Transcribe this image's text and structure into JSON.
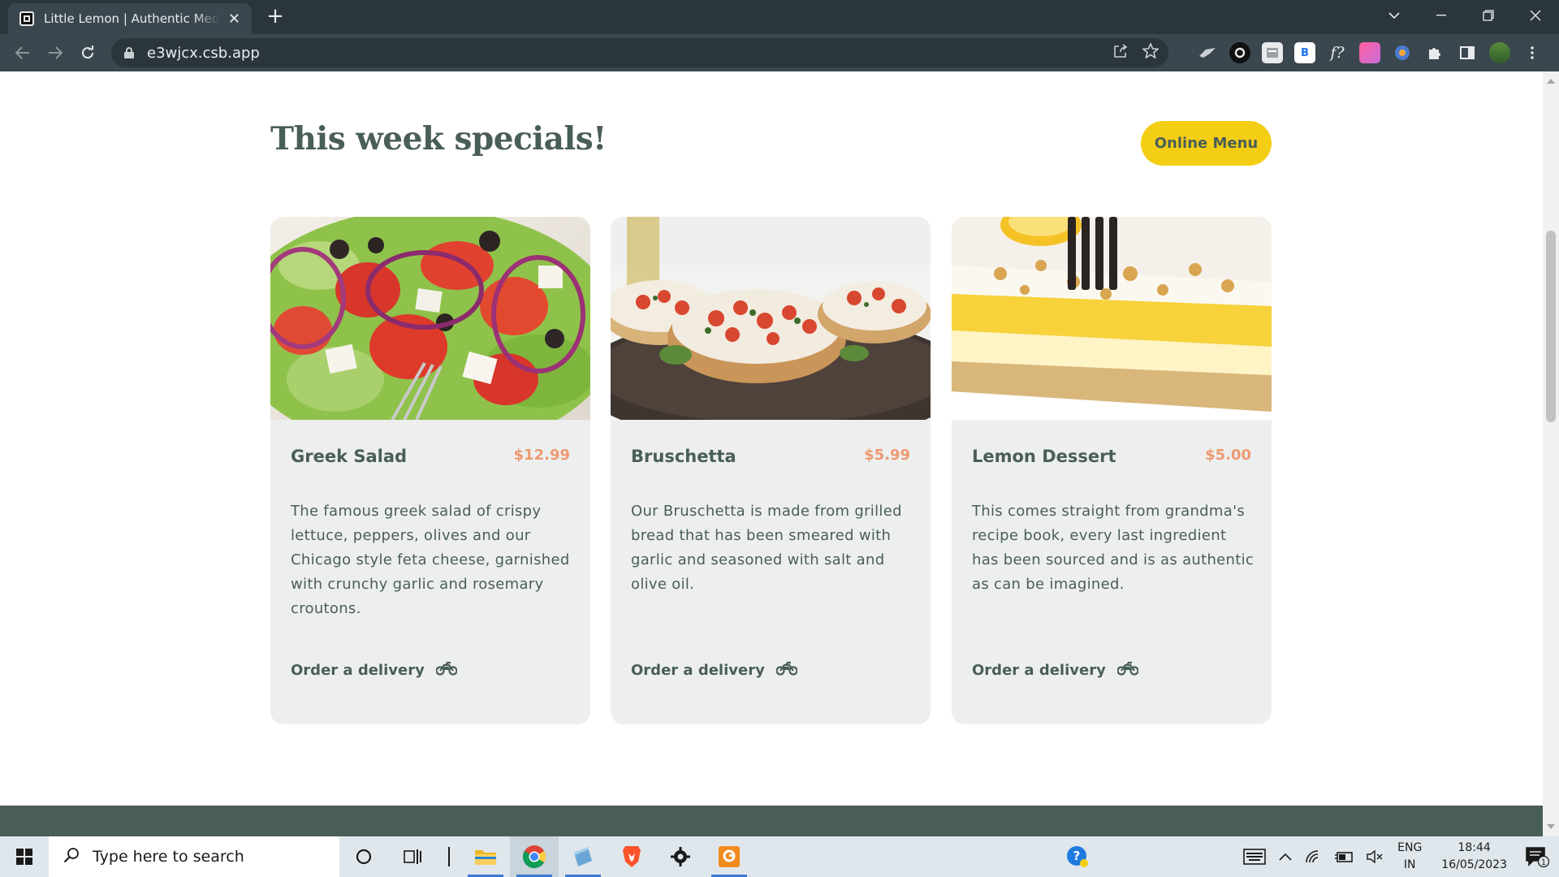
{
  "browser": {
    "tab_title": "Little Lemon | Authentic Mediterranean",
    "url": "e3wjcx.csb.app"
  },
  "page": {
    "section_title": "This week specials!",
    "online_menu_label": "Online Menu",
    "order_label": "Order a delivery",
    "cards": [
      {
        "name": "Greek Salad",
        "price": "$12.99",
        "description": "The famous greek salad of crispy lettuce, peppers, olives and our Chicago style feta cheese, garnished with crunchy garlic and rosemary croutons."
      },
      {
        "name": "Bruschetta",
        "price": "$5.99",
        "description": "Our Bruschetta is made from grilled bread that has been smeared with garlic and seasoned with salt and olive oil."
      },
      {
        "name": "Lemon Dessert",
        "price": "$5.00",
        "description": "This comes straight from grandma's recipe book, every last ingredient has been sourced and is as authentic as can be imagined."
      }
    ]
  },
  "taskbar": {
    "search_placeholder": "Type here to search",
    "lang_primary": "ENG",
    "lang_secondary": "IN",
    "time": "18:44",
    "date": "16/05/2023",
    "notification_count": "1"
  },
  "colors": {
    "primary_green": "#495e57",
    "primary_yellow": "#f4ce14",
    "price_orange": "#ee9972",
    "card_bg": "#edefee"
  }
}
